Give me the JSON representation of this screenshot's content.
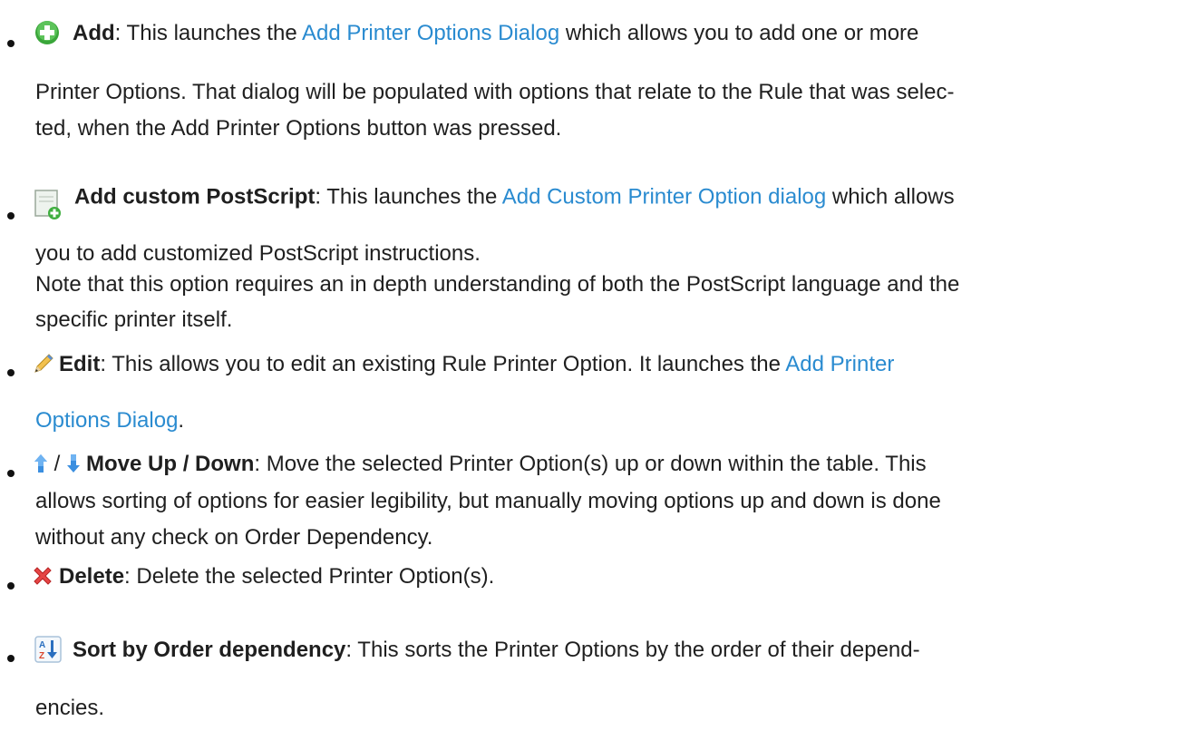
{
  "items": [
    {
      "icon": "add-green-circle-icon",
      "title": "Add",
      "t1": ": This launches the ",
      "link": "Add Printer Options Dialog",
      "t2": " which allows you to add one or more",
      "line2": "Printer Options. That dialog will be populated with options that relate to the Rule that was selec-",
      "line3": "ted, when the Add Printer Options button was pressed."
    },
    {
      "icon": "add-custom-postscript-icon",
      "title": "Add custom PostScript",
      "t1": ": This launches the ",
      "link": "Add Custom Printer Option dialog",
      "t2": " which allows",
      "line2": "you to add customized PostScript instructions.",
      "line3": "Note that this option requires an in depth understanding of both the PostScript language and the",
      "line4": "specific printer itself."
    },
    {
      "icon": "pencil-edit-icon",
      "title": "Edit",
      "t1": ": This allows you to edit an existing Rule Printer Option. It launches the ",
      "link_a": "Add Printer",
      "link_b": "Options Dialog",
      "t2": "."
    },
    {
      "icon_up": "arrow-up-icon",
      "icon_down": "arrow-down-icon",
      "sep": " / ",
      "title": "Move Up / Down",
      "t1": ": Move the selected Printer Option(s) up or down within the table. This",
      "line2": "allows sorting of options for easier legibility, but manually moving options up and down is done",
      "line3": "without any check on Order Dependency."
    },
    {
      "icon": "red-x-delete-icon",
      "title": "Delete",
      "t1": ": Delete the selected Printer Option(s)."
    },
    {
      "icon": "sort-az-icon",
      "title": "Sort by Order dependency",
      "t1": ": This sorts the Printer Options by the order of their depend-",
      "line2": "encies."
    }
  ]
}
